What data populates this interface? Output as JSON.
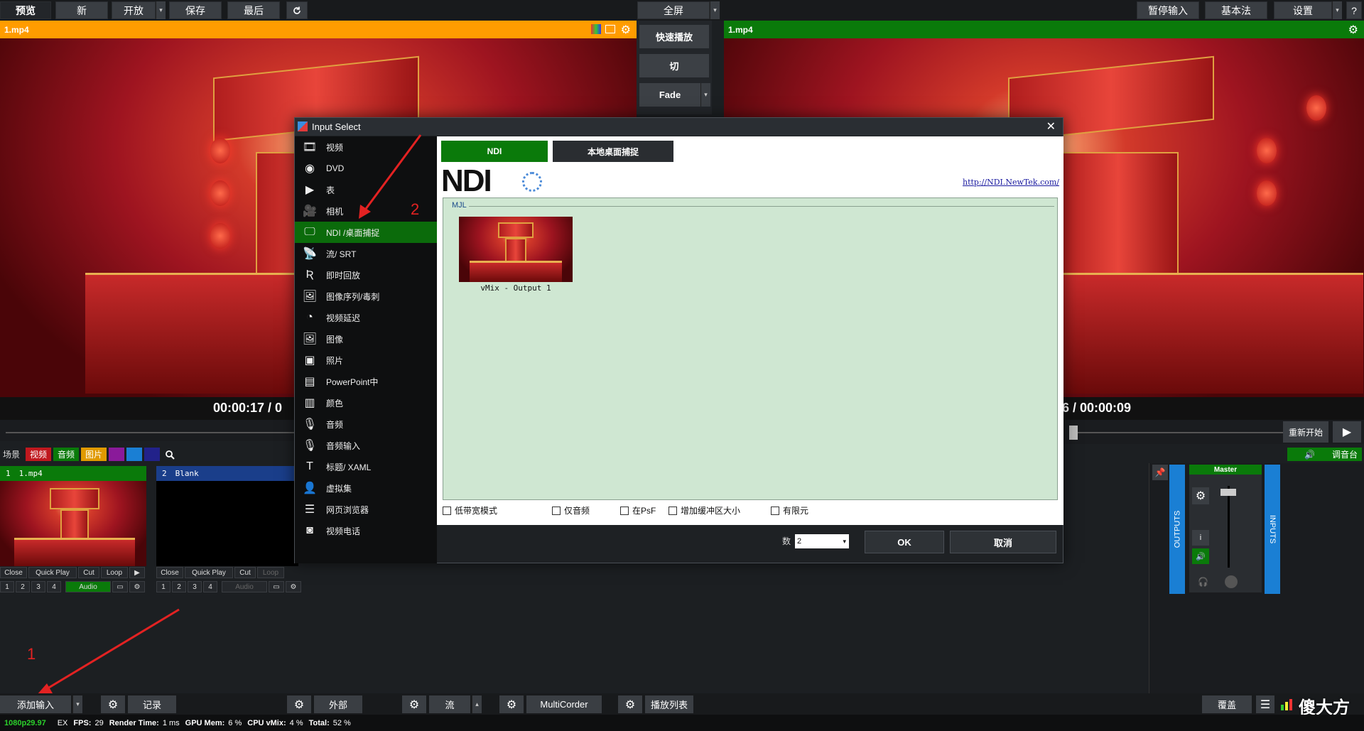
{
  "topbar": {
    "preview_label": "预览",
    "new_label": "新",
    "open_label": "开放",
    "save_label": "保存",
    "last_label": "最后",
    "fullscreen_label": "全屏",
    "pause_input_label": "暂停输入",
    "basic_label": "基本法",
    "settings_label": "设置",
    "help_label": "?"
  },
  "preview": {
    "title": "1.mp4",
    "timecode": "00:00:17  /  0"
  },
  "output": {
    "title": "1.mp4",
    "timecode": "6  /  00:00:09"
  },
  "transitions": {
    "quick_play": "快速播放",
    "cut": "切",
    "fade": "Fade"
  },
  "restart_label": "重新开始",
  "tabs": {
    "scene": "场景",
    "video": "视频",
    "audio": "音频",
    "image": "图片"
  },
  "mixer_label": "调音台",
  "inputs": [
    {
      "num": "1",
      "name": "1.mp4",
      "audio": "Audio"
    },
    {
      "num": "2",
      "name": "Blank",
      "audio": "Audio"
    }
  ],
  "input_buttons": {
    "close": "Close",
    "quick_play": "Quick Play",
    "cut": "Cut",
    "loop": "Loop"
  },
  "input_numbers": [
    "1",
    "2",
    "3",
    "4"
  ],
  "audio_panel": {
    "outputs": "OUTPUTS",
    "inputs": "INPUTS",
    "master": "Master",
    "info": "i"
  },
  "dialog": {
    "title": "Input Select",
    "categories": [
      {
        "icon": "film-icon",
        "label": "视频"
      },
      {
        "icon": "disc-icon",
        "label": "DVD"
      },
      {
        "icon": "playlist-icon",
        "label": "表"
      },
      {
        "icon": "camera-icon",
        "label": "相机"
      },
      {
        "icon": "monitor-icon",
        "label": "NDI /桌面捕捉"
      },
      {
        "icon": "antenna-icon",
        "label": "流/ SRT"
      },
      {
        "icon": "replay-icon",
        "label": "即时回放"
      },
      {
        "icon": "image-sequence-icon",
        "label": "图像序列/毒刺"
      },
      {
        "icon": "clock-icon",
        "label": "视频延迟"
      },
      {
        "icon": "image-icon",
        "label": "图像"
      },
      {
        "icon": "photos-icon",
        "label": "照片"
      },
      {
        "icon": "presentation-icon",
        "label": "PowerPoint中"
      },
      {
        "icon": "color-icon",
        "label": "颜色"
      },
      {
        "icon": "microphone-icon",
        "label": "音频"
      },
      {
        "icon": "microphone-input-icon",
        "label": "音频输入"
      },
      {
        "icon": "title-icon",
        "label": "标题/ XAML"
      },
      {
        "icon": "virtual-set-icon",
        "label": "虚拟集"
      },
      {
        "icon": "browser-icon",
        "label": "网页浏览器"
      },
      {
        "icon": "video-call-icon",
        "label": "视频电话"
      }
    ],
    "tabs": {
      "ndi": "NDI",
      "desktop": "本地桌面捕捉"
    },
    "ndi_logo": "NDI",
    "ndi_link": "http://NDI.NewTek.com/",
    "group_label": "MJL",
    "source_name": "vMix - Output 1",
    "options": {
      "low_bandwidth": "低带宽模式",
      "audio_only": "仅音频",
      "psf": "在PsF",
      "buffer": "增加缓冲区大小",
      "limited": "有限元"
    },
    "count_label": "数",
    "count_value": "2",
    "ok_label": "OK",
    "cancel_label": "取消"
  },
  "bottombar": {
    "add_input": "添加输入",
    "record": "记录",
    "external": "外部",
    "stream": "流",
    "multicorder": "MultiCorder",
    "playlist": "播放列表",
    "overlay": "覆盖",
    "watermark": "傻大方"
  },
  "status": {
    "format": "1080p29.97",
    "ex": "EX",
    "fps_label": "FPS:",
    "fps": "29",
    "render_label": "Render Time:",
    "render": "1 ms",
    "gpu_label": "GPU Mem:",
    "gpu": "6 %",
    "cpu_label": "CPU vMix:",
    "cpu": "4 %",
    "total_label": "Total:",
    "total": "52 %"
  },
  "annotations": {
    "one": "1",
    "two": "2"
  },
  "colors": {
    "preview_header": "#ff9c00",
    "output_header": "#0a7a0a",
    "selected": "#0b6b0b",
    "ndi_list_bg": "#cfe7d2",
    "accent_blue": "#1a7fd4"
  }
}
